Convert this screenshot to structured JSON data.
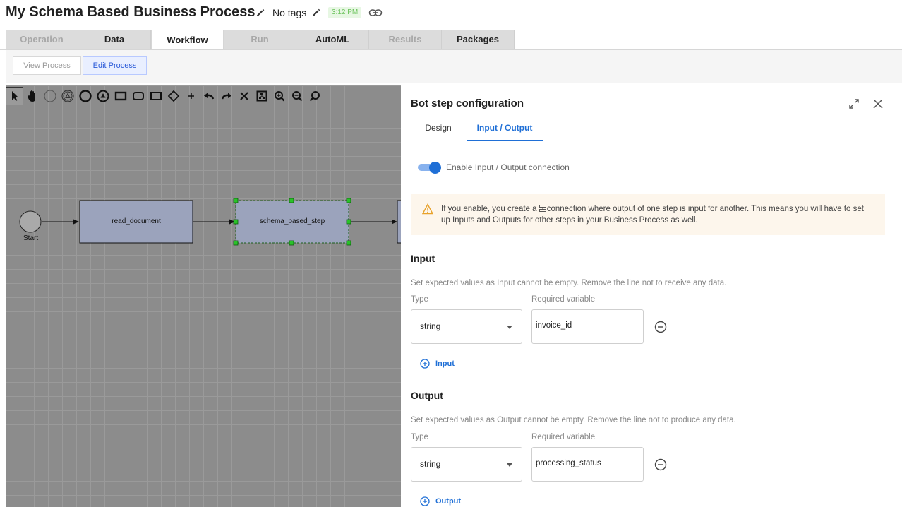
{
  "header": {
    "title": "My Schema Based Business Process",
    "tags_label": "No tags",
    "time": "3:12 PM"
  },
  "tabs": [
    {
      "label": "Operation",
      "state": "disabled"
    },
    {
      "label": "Data",
      "state": "normal"
    },
    {
      "label": "Workflow",
      "state": "active"
    },
    {
      "label": "Run",
      "state": "disabled"
    },
    {
      "label": "AutoML",
      "state": "normal"
    },
    {
      "label": "Results",
      "state": "disabled"
    },
    {
      "label": "Packages",
      "state": "normal"
    }
  ],
  "subtabs": {
    "view_label": "View Process",
    "edit_label": "Edit Process"
  },
  "toolbar_tools": [
    "pointer-tool",
    "hand-tool",
    "start-event-tool",
    "intermediate-event-tool",
    "end-event-tool",
    "signal-event-tool",
    "task-tool",
    "subprocess-tool",
    "data-tool",
    "gateway-tool",
    "add-tool",
    "undo-tool",
    "redo-tool",
    "delete-tool",
    "fit-tool",
    "zoom-in-tool",
    "zoom-out-tool",
    "zoom-reset-tool"
  ],
  "diagram": {
    "start_label": "Start",
    "node_1": "read_document",
    "node_2": "schema_based_step"
  },
  "panel": {
    "title": "Bot step configuration",
    "tabs": {
      "design": "Design",
      "io": "Input / Output"
    },
    "toggle_label": "Enable Input / Output connection",
    "toggle_on": true,
    "warning_prefix": "If you enable, you create a",
    "warning_rest": "connection where output of one step is input for another. This means you will have to set up Inputs and Outputs for other steps in your Business Process as well.",
    "input": {
      "title": "Input",
      "hint": "Set expected values as Input cannot be empty. Remove the line not to receive any data.",
      "type_label": "Type",
      "var_label": "Required variable",
      "type_value": "string",
      "var_value": "invoice_id",
      "add_label": "Input"
    },
    "output": {
      "title": "Output",
      "hint": "Set expected values as Output cannot be empty. Remove the line not to produce any data.",
      "type_label": "Type",
      "var_label": "Required variable",
      "type_value": "string",
      "var_value": "processing_status",
      "add_label": "Output"
    }
  },
  "colors": {
    "accent": "#1f6fd6",
    "node_fill": "#9ba3bc",
    "canvas": "#8c8c8c",
    "selection": "#1faa1f",
    "warning_bg": "#fdf6ec"
  }
}
